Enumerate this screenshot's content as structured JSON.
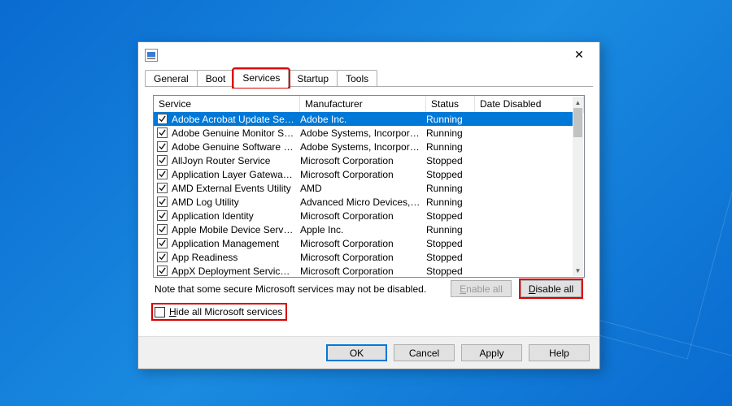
{
  "tabs": {
    "general": "General",
    "boot": "Boot",
    "services": "Services",
    "startup": "Startup",
    "tools": "Tools"
  },
  "columns": {
    "service": "Service",
    "manufacturer": "Manufacturer",
    "status": "Status",
    "date_disabled": "Date Disabled"
  },
  "services": [
    {
      "name": "Adobe Acrobat Update Service",
      "mfr": "Adobe Inc.",
      "status": "Running",
      "checked": true,
      "selected": true
    },
    {
      "name": "Adobe Genuine Monitor Service",
      "mfr": "Adobe Systems, Incorpora...",
      "status": "Running",
      "checked": true
    },
    {
      "name": "Adobe Genuine Software Integri...",
      "mfr": "Adobe Systems, Incorpora...",
      "status": "Running",
      "checked": true
    },
    {
      "name": "AllJoyn Router Service",
      "mfr": "Microsoft Corporation",
      "status": "Stopped",
      "checked": true
    },
    {
      "name": "Application Layer Gateway Service",
      "mfr": "Microsoft Corporation",
      "status": "Stopped",
      "checked": true
    },
    {
      "name": "AMD External Events Utility",
      "mfr": "AMD",
      "status": "Running",
      "checked": true
    },
    {
      "name": "AMD Log Utility",
      "mfr": "Advanced Micro Devices, I...",
      "status": "Running",
      "checked": true
    },
    {
      "name": "Application Identity",
      "mfr": "Microsoft Corporation",
      "status": "Stopped",
      "checked": true
    },
    {
      "name": "Apple Mobile Device Service",
      "mfr": "Apple Inc.",
      "status": "Running",
      "checked": true
    },
    {
      "name": "Application Management",
      "mfr": "Microsoft Corporation",
      "status": "Stopped",
      "checked": true
    },
    {
      "name": "App Readiness",
      "mfr": "Microsoft Corporation",
      "status": "Stopped",
      "checked": true
    },
    {
      "name": "AppX Deployment Service (AppX...",
      "mfr": "Microsoft Corporation",
      "status": "Stopped",
      "checked": true
    }
  ],
  "note": "Note that some secure Microsoft services may not be disabled.",
  "buttons": {
    "enable_all": "nable all",
    "enable_all_u": "E",
    "disable_all": "isable all",
    "disable_all_u": "D",
    "hide_ms": "ide all Microsoft services",
    "hide_ms_u": "H",
    "ok": "OK",
    "cancel": "Cancel",
    "apply": "Apply",
    "help": "Help"
  }
}
